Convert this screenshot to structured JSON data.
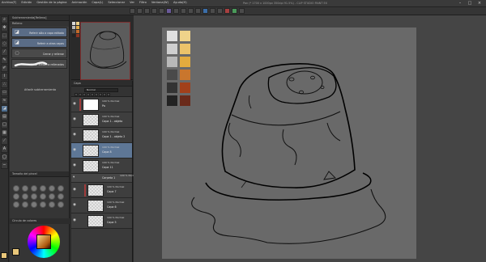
{
  "app": {
    "title": "Pan (* 1700 x 1000px 350dpi 91.5%) - CLIP STUDIO PAINT EX"
  },
  "menu": [
    "Archivo(F)",
    "Edición",
    "Gestión de la página",
    "Animación",
    "Capa(L)",
    "Seleccionar",
    "Ver",
    "Filtro",
    "Ventana(W)",
    "Ayuda(H)"
  ],
  "window_controls": [
    "–",
    "□",
    "×"
  ],
  "subtool_panel": {
    "tab": "Subherramienta[Relleno]",
    "header": "Relleno",
    "brushes": [
      {
        "label": "Referir sólo a capa editada",
        "icon": "bucket-icon",
        "selected": true
      },
      {
        "label": "Referir a otras capas",
        "icon": "bucket-icon",
        "selected": true
      },
      {
        "label": "Cerrar y rellenar",
        "icon": "lasso-fill-icon",
        "selected": false
      },
      {
        "label": "Pintar áreas no rellenadas",
        "icon": "brush-stroke-icon",
        "selected": false
      }
    ],
    "add_material": "Añadir subherramienta"
  },
  "brush_tip_panel": {
    "header": "Tamaño del pincel"
  },
  "color_wheel": {
    "header": "Círculo de colores",
    "current_color": "#e8c67a"
  },
  "layer_panel": {
    "tab": "Capa",
    "blend_mode": "Normal",
    "layers": [
      {
        "mode": "100 % Normal",
        "name": "Pa",
        "thumb": "white",
        "selected": false,
        "red": true
      },
      {
        "mode": "100 % Normal",
        "name": "Capa 1 - objeto",
        "thumb": "checker",
        "selected": false
      },
      {
        "mode": "100 % Normal",
        "name": "Capa 1 - objeto 2",
        "thumb": "checker",
        "selected": false
      },
      {
        "mode": "100 % Normal",
        "name": "Capa 8",
        "thumb": "checker",
        "selected": true
      },
      {
        "mode": "100 % Normal",
        "name": "Capa 11",
        "thumb": "checker",
        "selected": false
      }
    ],
    "folder": {
      "mode": "100 % Normal",
      "name": "Carpeta 1"
    },
    "sublayers": [
      {
        "mode": "100 % Normal",
        "name": "Capa 7"
      },
      {
        "mode": "100 % Normal",
        "name": "Capa 6"
      },
      {
        "mode": "100 % Normal",
        "name": "Capa 5"
      }
    ]
  },
  "canvas_palette": {
    "colors": [
      "#e0e0e0",
      "#efd38a",
      "#cfcfcf",
      "#ecc36a",
      "#b8b8b8",
      "#e3ab3e",
      "#4a4a4a",
      "#c9762d",
      "#333333",
      "#a2401a",
      "#222222",
      "#6a2a1a"
    ]
  },
  "nav_palette": {
    "colors": [
      "#d9d9d9",
      "#ecd08a",
      "#bdbdbd",
      "#e3ad4a",
      "#4a4a4a",
      "#c26b2a",
      "#222222",
      "#8a3320"
    ]
  },
  "colors": {
    "workarea": "#454545",
    "canvas": "#696969",
    "selection": "#5e7796",
    "accent_red": "#a13b3b"
  }
}
